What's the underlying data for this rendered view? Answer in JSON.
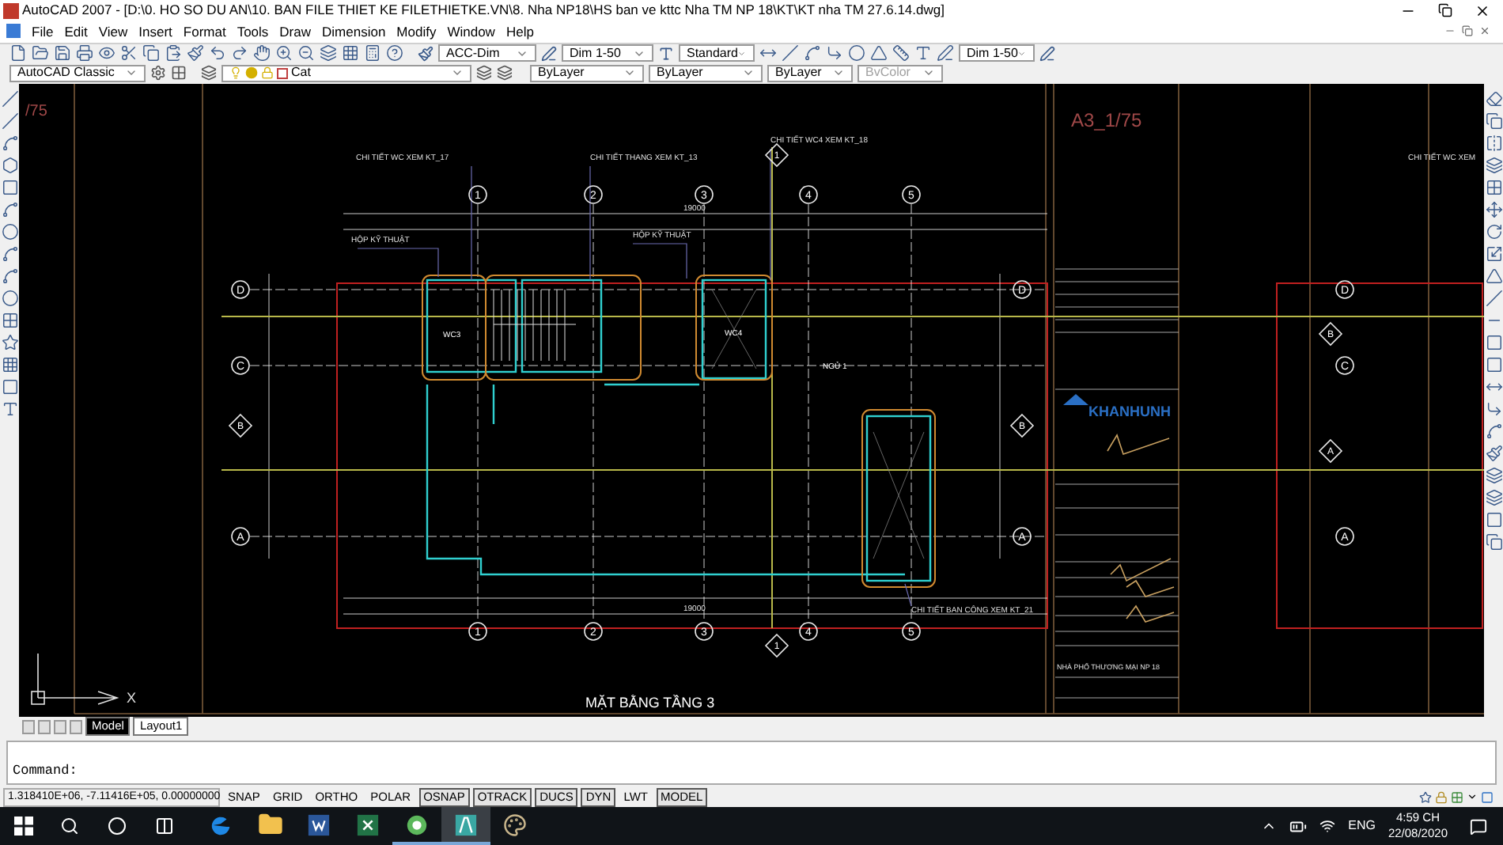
{
  "window": {
    "title": "AutoCAD 2007 - [D:\\0. HO SO DU AN\\10. BAN FILE THIET KE FILETHIETKE.VN\\8. Nha NP18\\HS ban ve kttc Nha TM NP 18\\KT\\KT nha TM 27.6.14.dwg]"
  },
  "menu": [
    "File",
    "Edit",
    "View",
    "Insert",
    "Format",
    "Tools",
    "Draw",
    "Dimension",
    "Modify",
    "Window",
    "Help"
  ],
  "toolbar_1": {
    "dim_style": "ACC-Dim",
    "dim_scale": "Dim 1-50",
    "text_style": "Standard",
    "dim_scale_2": "Dim 1-50"
  },
  "toolbar_2": {
    "workspace": "AutoCAD Classic",
    "layer": "Cat",
    "object_color": "ByLayer",
    "linetype": "ByLayer",
    "lineweight": "ByLayer",
    "plot_style": {
      "value": "BvColor",
      "disabled": true
    }
  },
  "drawing": {
    "sheet_scale_left": "/75",
    "sheet_scale": "A3_1/75",
    "title": "MẶT BẰNG TẦNG 3",
    "top_axes": [
      "1",
      "2",
      "3",
      "4",
      "5"
    ],
    "bottom_axes": [
      "1",
      "2",
      "3",
      "4",
      "5"
    ],
    "left_axes": [
      {
        "label": "D",
        "kind": "circle"
      },
      {
        "label": "C",
        "kind": "circle"
      },
      {
        "label": "B",
        "kind": "diamond"
      },
      {
        "label": "A",
        "kind": "circle"
      }
    ],
    "right_axes": [
      {
        "label": "D",
        "kind": "circle"
      },
      {
        "label": "B",
        "kind": "diamond"
      },
      {
        "label": "A",
        "kind": "circle"
      }
    ],
    "far_axes": [
      {
        "label": "D",
        "kind": "circle"
      },
      {
        "label": "B",
        "kind": "diamond"
      },
      {
        "label": "C",
        "kind": "circle"
      },
      {
        "label": "A",
        "kind": "diamond"
      },
      {
        "label": "A",
        "kind": "circle"
      }
    ],
    "section_marks": [
      "1",
      "1"
    ],
    "callouts": [
      "CHI TIẾT WC XEM KT_17",
      "CHI TIẾT THANG XEM KT_13",
      "CHI TIẾT WC4 XEM KT_18",
      "HỘP KỸ THUẬT",
      "HỘP KỸ THUẬT",
      "CHI TIẾT BAN CÔNG XEM KT_21",
      "CHI TIẾT WC XEM"
    ],
    "overall_dims": [
      "19000",
      "19000"
    ],
    "rooms": [
      "WC3",
      "WC4",
      "NGỦ 1"
    ],
    "ucs_label": "X",
    "title_block": {
      "logo": "KHANHUNH",
      "project": "NHÀ PHỐ THƯƠNG MẠI NP 18"
    }
  },
  "layout_tabs": [
    {
      "label": "Model",
      "selected": true
    },
    {
      "label": "Layout1",
      "selected": false
    }
  ],
  "command": {
    "prompt": "Command:"
  },
  "status_bar": {
    "coordinates": "1.318410E+06, -7.11416E+05, 0.00000000",
    "toggles": [
      {
        "label": "SNAP",
        "on": false
      },
      {
        "label": "GRID",
        "on": false
      },
      {
        "label": "ORTHO",
        "on": false
      },
      {
        "label": "POLAR",
        "on": false
      },
      {
        "label": "OSNAP",
        "on": true
      },
      {
        "label": "OTRACK",
        "on": true
      },
      {
        "label": "DUCS",
        "on": true
      },
      {
        "label": "DYN",
        "on": true
      },
      {
        "label": "LWT",
        "on": false
      },
      {
        "label": "MODEL",
        "on": true
      }
    ]
  },
  "taskbar": {
    "apps": [
      {
        "kind": "edge",
        "running": false,
        "selected": false
      },
      {
        "kind": "explorer",
        "running": false,
        "selected": false
      },
      {
        "kind": "word",
        "running": false,
        "selected": false
      },
      {
        "kind": "excel",
        "running": false,
        "selected": false
      },
      {
        "kind": "green",
        "running": true,
        "selected": false
      },
      {
        "kind": "autocad",
        "running": true,
        "selected": true
      },
      {
        "kind": "paint",
        "running": false,
        "selected": false
      }
    ],
    "language": "ENG",
    "time": "4:59 CH",
    "date": "22/08/2020"
  }
}
